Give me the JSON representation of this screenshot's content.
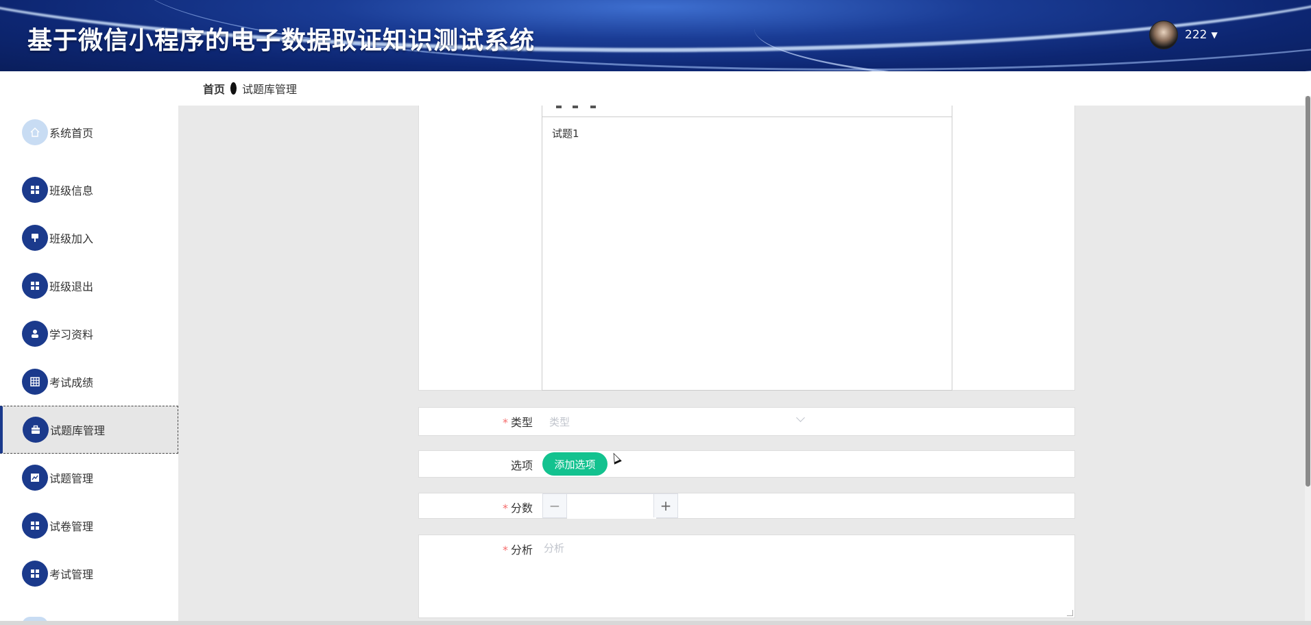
{
  "header": {
    "title": "基于微信小程序的电子数据取证知识测试系统",
    "username": "222",
    "caret": "▼"
  },
  "breadcrumb": {
    "home": "首页",
    "current": "试题库管理"
  },
  "sidebar": {
    "items": [
      {
        "label": "系统首页",
        "icon": "home-icon"
      },
      {
        "label": "班级信息",
        "icon": "grid-icon"
      },
      {
        "label": "班级加入",
        "icon": "pin-icon"
      },
      {
        "label": "班级退出",
        "icon": "grid-icon"
      },
      {
        "label": "学习资料",
        "icon": "user-icon"
      },
      {
        "label": "考试成绩",
        "icon": "table-icon"
      },
      {
        "label": "试题库管理",
        "icon": "briefcase-icon"
      },
      {
        "label": "试题管理",
        "icon": "chart-icon"
      },
      {
        "label": "试卷管理",
        "icon": "grid-icon"
      },
      {
        "label": "考试管理",
        "icon": "grid-icon"
      }
    ],
    "active_index": 6
  },
  "form": {
    "editor_text": "试题1",
    "type": {
      "label": "类型",
      "placeholder": "类型",
      "required": true
    },
    "options": {
      "label": "选项",
      "button": "添加选项",
      "required": false
    },
    "score": {
      "label": "分数",
      "value": "",
      "required": true,
      "minus": "−",
      "plus": "+"
    },
    "analysis": {
      "label": "分析",
      "placeholder": "分析",
      "required": true
    },
    "required_mark": "*"
  },
  "colors": {
    "primary": "#1b3a8c",
    "accent_green": "#13c28f",
    "required": "#f56c6c"
  }
}
